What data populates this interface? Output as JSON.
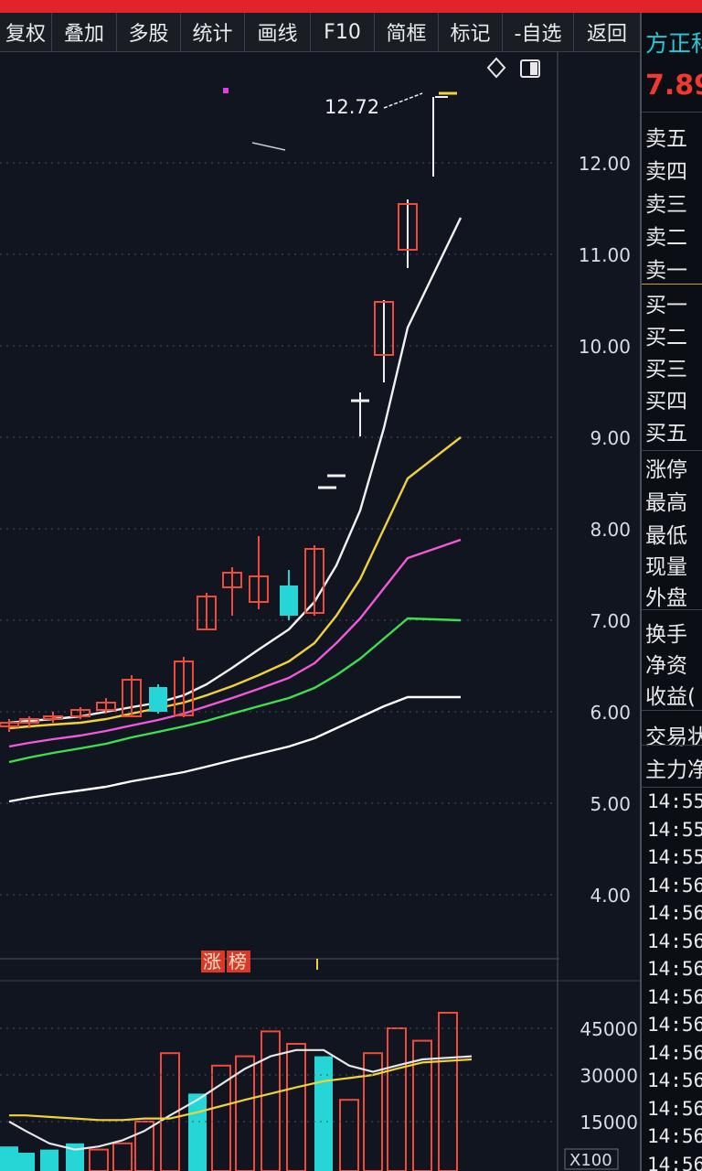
{
  "toolbar": {
    "buttons": [
      "复权",
      "叠加",
      "多股",
      "统计",
      "画线",
      "F10",
      "简框",
      "标记",
      "-自选",
      "返回"
    ]
  },
  "quote": {
    "name": "方正科",
    "price": "7.89"
  },
  "order_book": {
    "sell": [
      "卖五",
      "卖四",
      "卖三",
      "卖二",
      "卖一"
    ],
    "buy": [
      "买一",
      "买二",
      "买三",
      "买四",
      "买五"
    ]
  },
  "stats": [
    "涨停",
    "最高",
    "最低",
    "现量",
    "外盘",
    "换手",
    "净资",
    "收益(",
    "交易状",
    "主力净"
  ],
  "ticks": {
    "times": [
      "14:55",
      "14:55",
      "14:55",
      "14:56",
      "14:56",
      "14:56",
      "14:56",
      "14:56",
      "14:56",
      "14:56",
      "14:56",
      "14:56",
      "14:56",
      "14:56"
    ]
  },
  "icons": {
    "diamond": "diamond-icon",
    "panel": "panel-toggle-icon"
  },
  "colors": {
    "up": "#f04a3a",
    "down": "#26d6d6",
    "ma1": "#f2f2f2",
    "ma2": "#f2d23a",
    "ma3": "#f05ad8",
    "ma4": "#3ee050",
    "ma5": "#ffffff"
  },
  "chart_data": [
    {
      "type": "candlestick",
      "title": "",
      "price_axis": {
        "ticks": [
          "12.00",
          "11.00",
          "10.00",
          "9.00",
          "8.00",
          "7.00",
          "6.00",
          "5.00",
          "4.00"
        ],
        "range": [
          3.3,
          13.0
        ]
      },
      "annotations": {
        "max_label": "12.72",
        "badge": [
          "涨",
          "榜"
        ]
      },
      "candles": [
        {
          "o": 5.84,
          "h": 5.92,
          "l": 5.78,
          "c": 5.88
        },
        {
          "o": 5.88,
          "h": 5.95,
          "l": 5.82,
          "c": 5.92
        },
        {
          "o": 5.92,
          "h": 6.0,
          "l": 5.88,
          "c": 5.95
        },
        {
          "o": 5.95,
          "h": 6.05,
          "l": 5.92,
          "c": 6.02
        },
        {
          "o": 6.02,
          "h": 6.15,
          "l": 5.98,
          "c": 6.1
        },
        {
          "o": 5.95,
          "h": 6.4,
          "l": 5.95,
          "c": 6.35
        },
        {
          "o": 6.27,
          "h": 6.3,
          "l": 5.98,
          "c": 6.0
        },
        {
          "o": 5.96,
          "h": 6.6,
          "l": 5.94,
          "c": 6.55
        },
        {
          "o": 6.9,
          "h": 7.3,
          "l": 6.9,
          "c": 7.26
        },
        {
          "o": 7.36,
          "h": 7.58,
          "l": 7.05,
          "c": 7.52
        },
        {
          "o": 7.2,
          "h": 7.92,
          "l": 7.12,
          "c": 7.48
        },
        {
          "o": 7.38,
          "h": 7.55,
          "l": 7.0,
          "c": 7.05
        },
        {
          "o": 7.08,
          "h": 7.82,
          "l": 7.05,
          "c": 7.78
        },
        {
          "o": 8.58,
          "h": 8.58,
          "l": 8.58,
          "c": 8.58
        },
        {
          "o": 9.4,
          "h": 9.49,
          "l": 9.01,
          "c": 9.4
        },
        {
          "o": 9.9,
          "h": 10.5,
          "l": 9.6,
          "c": 10.48
        },
        {
          "o": 11.05,
          "h": 11.6,
          "l": 10.85,
          "c": 11.55
        },
        {
          "o": 12.72,
          "h": 12.72,
          "l": 11.85,
          "c": 12.72
        }
      ],
      "moving_averages": [
        {
          "color": "#f2f2f2",
          "values": [
            5.88,
            5.9,
            5.92,
            5.95,
            6.0,
            6.05,
            6.1,
            6.18,
            6.3,
            6.48,
            6.68,
            6.9,
            7.2,
            7.6,
            8.2,
            9.1,
            10.2,
            11.4
          ]
        },
        {
          "color": "#f2d23a",
          "values": [
            5.82,
            5.84,
            5.86,
            5.88,
            5.92,
            5.98,
            6.04,
            6.1,
            6.18,
            6.28,
            6.4,
            6.55,
            6.75,
            7.05,
            7.45,
            8.0,
            8.55,
            9.0
          ]
        },
        {
          "color": "#f05ad8",
          "values": [
            5.62,
            5.66,
            5.7,
            5.74,
            5.79,
            5.85,
            5.91,
            5.98,
            6.06,
            6.15,
            6.25,
            6.37,
            6.53,
            6.75,
            7.02,
            7.35,
            7.68,
            7.88
          ]
        },
        {
          "color": "#3ee050",
          "values": [
            5.45,
            5.5,
            5.55,
            5.6,
            5.65,
            5.72,
            5.78,
            5.84,
            5.9,
            5.98,
            6.06,
            6.15,
            6.26,
            6.4,
            6.58,
            6.8,
            7.02,
            7.0
          ]
        },
        {
          "color": "#ffffff",
          "values": [
            5.02,
            5.06,
            5.1,
            5.14,
            5.18,
            5.24,
            5.29,
            5.34,
            5.4,
            5.47,
            5.54,
            5.62,
            5.71,
            5.82,
            5.94,
            6.06,
            6.16,
            6.16
          ]
        }
      ]
    },
    {
      "type": "bar",
      "title": "",
      "volume_axis": {
        "ticks": [
          "45000",
          "30000",
          "15000"
        ],
        "range": [
          0,
          55000
        ],
        "unit_label": "X100"
      },
      "bars": [
        {
          "v": 7000,
          "up": false
        },
        {
          "v": 5000,
          "up": false
        },
        {
          "v": 6000,
          "up": false
        },
        {
          "v": 8000,
          "up": false
        },
        {
          "v": 6000,
          "up": true
        },
        {
          "v": 8000,
          "up": true
        },
        {
          "v": 15000,
          "up": true
        },
        {
          "v": 37000,
          "up": true
        },
        {
          "v": 24000,
          "up": false
        },
        {
          "v": 33000,
          "up": true
        },
        {
          "v": 36000,
          "up": true
        },
        {
          "v": 44000,
          "up": true
        },
        {
          "v": 40000,
          "up": true
        },
        {
          "v": 36000,
          "up": false
        },
        {
          "v": 22000,
          "up": true
        },
        {
          "v": 37000,
          "up": true
        },
        {
          "v": 45000,
          "up": true
        },
        {
          "v": 41000,
          "up": true
        },
        {
          "v": 50000,
          "up": true
        }
      ],
      "moving_averages": [
        {
          "color": "#e6e6e6",
          "values": [
            15000,
            12000,
            8000,
            6000,
            7000,
            9000,
            12000,
            17000,
            22000,
            27000,
            32000,
            36000,
            38000,
            38000,
            33000,
            31000,
            33000,
            35000,
            36000
          ]
        },
        {
          "color": "#f2d23a",
          "values": [
            17000,
            17000,
            16500,
            16000,
            15500,
            15500,
            16000,
            16000,
            18000,
            20000,
            22000,
            24000,
            26000,
            28000,
            29000,
            30000,
            32000,
            34000,
            35000
          ]
        }
      ]
    }
  ]
}
